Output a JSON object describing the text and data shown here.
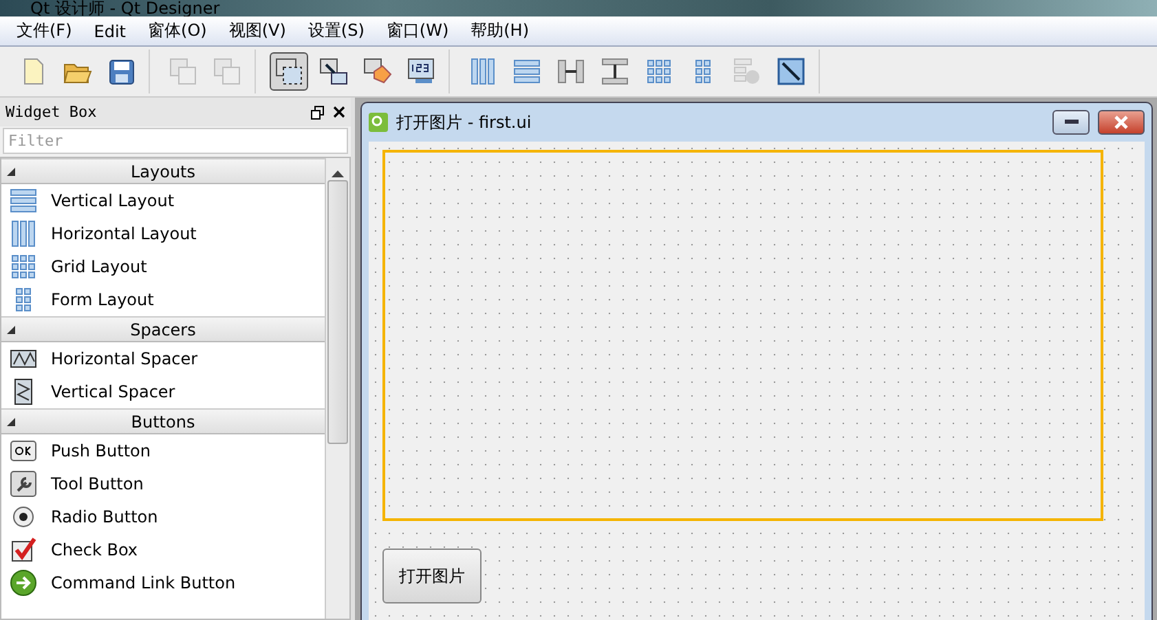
{
  "window": {
    "title": "Qt 设计师 - Qt Designer"
  },
  "menu": [
    {
      "label": "文件(F)"
    },
    {
      "label": "Edit"
    },
    {
      "label": "窗体(O)"
    },
    {
      "label": "视图(V)"
    },
    {
      "label": "设置(S)"
    },
    {
      "label": "窗口(W)"
    },
    {
      "label": "帮助(H)"
    }
  ],
  "toolbar": [
    [
      {
        "kind": "new",
        "selected": false,
        "disabled": false
      },
      {
        "kind": "open",
        "selected": false,
        "disabled": false
      },
      {
        "kind": "save",
        "selected": false,
        "disabled": false
      }
    ],
    [
      {
        "kind": "back",
        "selected": false,
        "disabled": true
      },
      {
        "kind": "front",
        "selected": false,
        "disabled": true
      }
    ],
    [
      {
        "kind": "widgets",
        "selected": true,
        "disabled": false
      },
      {
        "kind": "signals",
        "selected": false,
        "disabled": false
      },
      {
        "kind": "buddy",
        "selected": false,
        "disabled": false
      },
      {
        "kind": "taborder",
        "selected": false,
        "disabled": false
      }
    ],
    [
      {
        "kind": "hlayout",
        "selected": false,
        "disabled": false
      },
      {
        "kind": "vlayout",
        "selected": false,
        "disabled": false
      },
      {
        "kind": "hsplit",
        "selected": false,
        "disabled": false
      },
      {
        "kind": "vsplit",
        "selected": false,
        "disabled": false
      },
      {
        "kind": "grid",
        "selected": false,
        "disabled": false
      },
      {
        "kind": "form",
        "selected": false,
        "disabled": false
      },
      {
        "kind": "break",
        "selected": false,
        "disabled": true
      },
      {
        "kind": "adjust",
        "selected": false,
        "disabled": false
      }
    ]
  ],
  "widget_box": {
    "title": "Widget Box",
    "filter": {
      "placeholder": "Filter"
    },
    "categories": [
      {
        "name": "Layouts",
        "expanded": true,
        "items": [
          {
            "label": "Vertical Layout",
            "kind": "vlayout"
          },
          {
            "label": "Horizontal Layout",
            "kind": "hlayout"
          },
          {
            "label": "Grid Layout",
            "kind": "grid"
          },
          {
            "label": "Form Layout",
            "kind": "form"
          }
        ]
      },
      {
        "name": "Spacers",
        "expanded": true,
        "items": [
          {
            "label": "Horizontal Spacer",
            "kind": "hspacer"
          },
          {
            "label": "Vertical Spacer",
            "kind": "vspacer"
          }
        ]
      },
      {
        "name": "Buttons",
        "expanded": true,
        "items": [
          {
            "label": "Push Button",
            "kind": "push"
          },
          {
            "label": "Tool Button",
            "kind": "tool"
          },
          {
            "label": "Radio Button",
            "kind": "radio"
          },
          {
            "label": "Check Box",
            "kind": "check"
          },
          {
            "label": "Command Link Button",
            "kind": "cmdlink"
          }
        ]
      }
    ]
  },
  "form": {
    "title": "打开图片 - first.ui",
    "button": {
      "label": "打开图片"
    }
  }
}
